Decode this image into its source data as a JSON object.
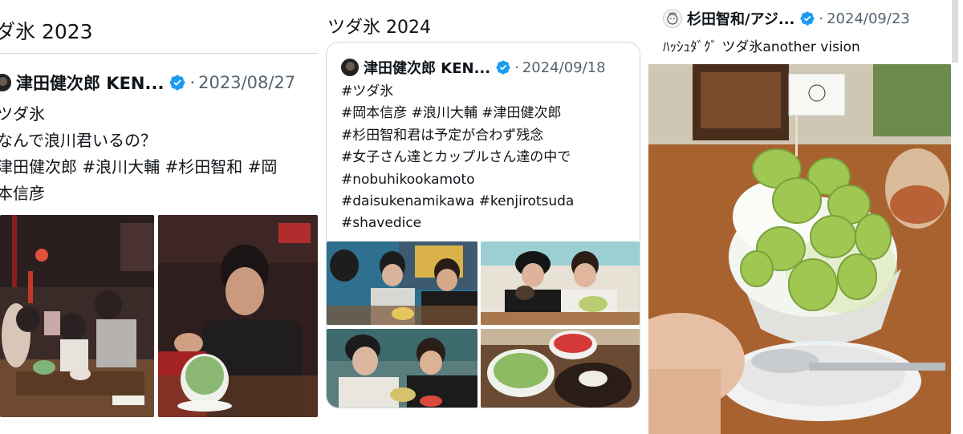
{
  "col1": {
    "heading": "ダ氷 2023",
    "author": "津田健次郎 KEN...",
    "separator": "·",
    "date": "2023/08/27",
    "lines": [
      "ツダ氷",
      "なんで浪川君いるの？",
      "津田健次郎 #浪川大輔 #杉田智和 #岡",
      "本信彦"
    ]
  },
  "col2": {
    "heading": "ツダ氷 2024",
    "author": "津田健次郎 KEN...",
    "separator": "·",
    "date": "2024/09/18",
    "lines": [
      "#ツダ氷",
      "#岡本信彦 #浪川大輔 #津田健次郎",
      "#杉田智和君は予定が合わず残念",
      "#女子さん達とカップルさん達の中で",
      "#nobuhikookamoto",
      "#daisukenamikawa #kenjirotsuda",
      "#shavedice"
    ]
  },
  "col3": {
    "author": "杉田智和/アジ...",
    "separator": "·",
    "date": "2024/09/23",
    "text": "ﾊｯｼｭﾀﾞｸﾞ ツダ氷another vision"
  },
  "icons": {
    "verified": "verified-badge-icon"
  },
  "colors": {
    "verified": "#1d9bf0",
    "muted": "#536471",
    "border": "#cfd9de"
  }
}
